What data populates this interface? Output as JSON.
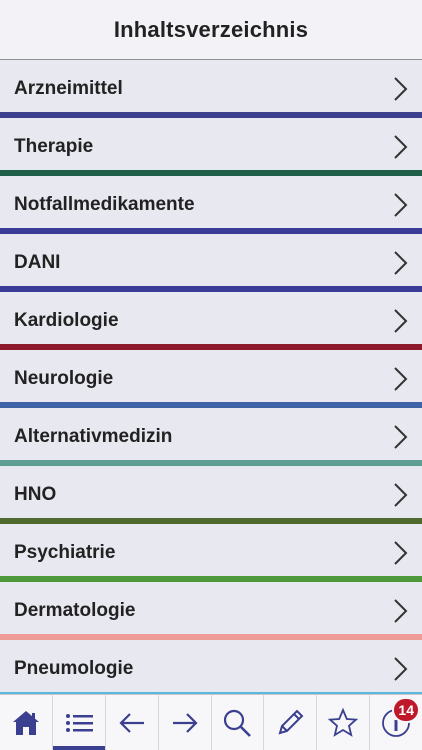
{
  "header": {
    "title": "Inhaltsverzeichnis"
  },
  "list": {
    "items": [
      {
        "label": "Arzneimittel",
        "color": "#3d3f8f"
      },
      {
        "label": "Therapie",
        "color": "#1f5f4a"
      },
      {
        "label": "Notfallmedikamente",
        "color": "#3a3d96"
      },
      {
        "label": "DANI",
        "color": "#3a3d96"
      },
      {
        "label": "Kardiologie",
        "color": "#8e1b2b"
      },
      {
        "label": "Neurologie",
        "color": "#3d63a6"
      },
      {
        "label": "Alternativmedizin",
        "color": "#5f9e93"
      },
      {
        "label": "HNO",
        "color": "#4e6a2e"
      },
      {
        "label": "Psychiatrie",
        "color": "#4e9a3a"
      },
      {
        "label": "Dermatologie",
        "color": "#ef9b98"
      },
      {
        "label": "Pneumologie",
        "color": "#5bb6e0"
      }
    ]
  },
  "tabbar": {
    "tabs": [
      {
        "icon": "home-icon"
      },
      {
        "icon": "list-icon"
      },
      {
        "icon": "back-arrow-icon"
      },
      {
        "icon": "forward-arrow-icon"
      },
      {
        "icon": "search-icon"
      },
      {
        "icon": "pencil-icon"
      },
      {
        "icon": "star-icon"
      },
      {
        "icon": "info-icon",
        "badge": "14"
      }
    ],
    "accent": "#3b3f8f",
    "badge_color": "#c0182b"
  }
}
